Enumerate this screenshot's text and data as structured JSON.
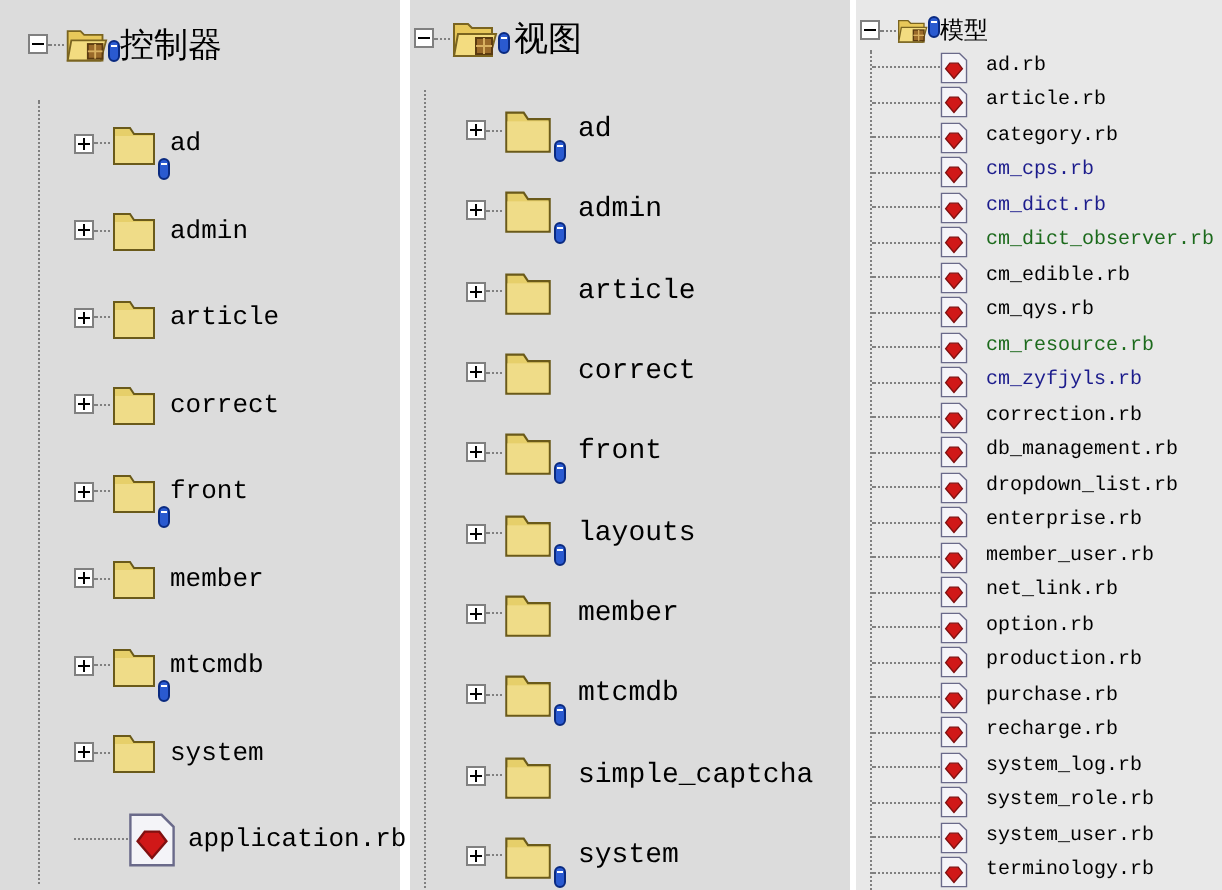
{
  "panels": [
    {
      "root": {
        "label": "控制器",
        "expanded": true,
        "marked": true
      },
      "items": [
        {
          "kind": "folder",
          "label": "ad",
          "expanded": false,
          "marked": true
        },
        {
          "kind": "folder",
          "label": "admin",
          "expanded": false,
          "marked": false
        },
        {
          "kind": "folder",
          "label": "article",
          "expanded": false,
          "marked": false
        },
        {
          "kind": "folder",
          "label": "correct",
          "expanded": false,
          "marked": false
        },
        {
          "kind": "folder",
          "label": "front",
          "expanded": false,
          "marked": true
        },
        {
          "kind": "folder",
          "label": "member",
          "expanded": false,
          "marked": false
        },
        {
          "kind": "folder",
          "label": "mtcmdb",
          "expanded": false,
          "marked": true
        },
        {
          "kind": "folder",
          "label": "system",
          "expanded": false,
          "marked": false
        },
        {
          "kind": "file",
          "label": "application.rb",
          "marked": false
        }
      ]
    },
    {
      "root": {
        "label": "视图",
        "expanded": true,
        "marked": true
      },
      "items": [
        {
          "kind": "folder",
          "label": "ad",
          "expanded": false,
          "marked": true
        },
        {
          "kind": "folder",
          "label": "admin",
          "expanded": false,
          "marked": true
        },
        {
          "kind": "folder",
          "label": "article",
          "expanded": false,
          "marked": false
        },
        {
          "kind": "folder",
          "label": "correct",
          "expanded": false,
          "marked": false
        },
        {
          "kind": "folder",
          "label": "front",
          "expanded": false,
          "marked": true
        },
        {
          "kind": "folder",
          "label": "layouts",
          "expanded": false,
          "marked": true
        },
        {
          "kind": "folder",
          "label": "member",
          "expanded": false,
          "marked": false
        },
        {
          "kind": "folder",
          "label": "mtcmdb",
          "expanded": false,
          "marked": true
        },
        {
          "kind": "folder",
          "label": "simple_captcha",
          "expanded": false,
          "marked": false
        },
        {
          "kind": "folder",
          "label": "system",
          "expanded": false,
          "marked": true
        }
      ]
    },
    {
      "root": {
        "label": "模型",
        "expanded": true,
        "marked": true
      },
      "items": [
        {
          "kind": "file",
          "label": "ad.rb",
          "marked": false,
          "color": "#000000"
        },
        {
          "kind": "file",
          "label": "article.rb",
          "marked": false,
          "color": "#000000"
        },
        {
          "kind": "file",
          "label": "category.rb",
          "marked": false,
          "color": "#000000"
        },
        {
          "kind": "file",
          "label": "cm_cps.rb",
          "marked": false,
          "color": "#1c1c8c"
        },
        {
          "kind": "file",
          "label": "cm_dict.rb",
          "marked": false,
          "color": "#1c1c8c"
        },
        {
          "kind": "file",
          "label": "cm_dict_observer.rb",
          "marked": false,
          "color": "#1c6a1c"
        },
        {
          "kind": "file",
          "label": "cm_edible.rb",
          "marked": false,
          "color": "#000000"
        },
        {
          "kind": "file",
          "label": "cm_qys.rb",
          "marked": false,
          "color": "#000000"
        },
        {
          "kind": "file",
          "label": "cm_resource.rb",
          "marked": false,
          "color": "#1c6a1c"
        },
        {
          "kind": "file",
          "label": "cm_zyfjyls.rb",
          "marked": false,
          "color": "#1c1c8c"
        },
        {
          "kind": "file",
          "label": "correction.rb",
          "marked": false,
          "color": "#000000"
        },
        {
          "kind": "file",
          "label": "db_management.rb",
          "marked": false,
          "color": "#000000"
        },
        {
          "kind": "file",
          "label": "dropdown_list.rb",
          "marked": false,
          "color": "#000000"
        },
        {
          "kind": "file",
          "label": "enterprise.rb",
          "marked": false,
          "color": "#000000"
        },
        {
          "kind": "file",
          "label": "member_user.rb",
          "marked": false,
          "color": "#000000"
        },
        {
          "kind": "file",
          "label": "net_link.rb",
          "marked": false,
          "color": "#000000"
        },
        {
          "kind": "file",
          "label": "option.rb",
          "marked": false,
          "color": "#000000"
        },
        {
          "kind": "file",
          "label": "production.rb",
          "marked": false,
          "color": "#000000"
        },
        {
          "kind": "file",
          "label": "purchase.rb",
          "marked": false,
          "color": "#000000"
        },
        {
          "kind": "file",
          "label": "recharge.rb",
          "marked": false,
          "color": "#000000"
        },
        {
          "kind": "file",
          "label": "system_log.rb",
          "marked": false,
          "color": "#000000"
        },
        {
          "kind": "file",
          "label": "system_role.rb",
          "marked": false,
          "color": "#000000"
        },
        {
          "kind": "file",
          "label": "system_user.rb",
          "marked": false,
          "color": "#000000"
        },
        {
          "kind": "file",
          "label": "terminology.rb",
          "marked": false,
          "color": "#000000"
        }
      ]
    }
  ]
}
